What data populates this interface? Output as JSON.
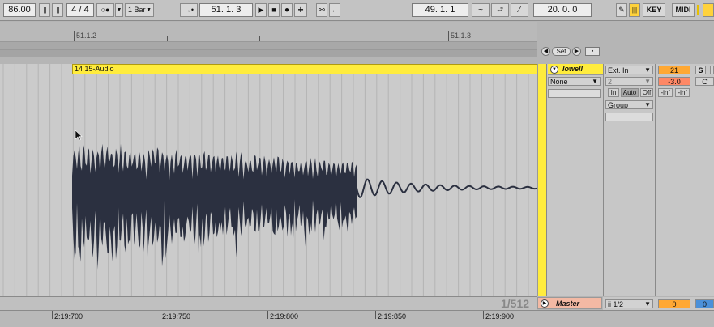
{
  "transport": {
    "tempo": "86.00",
    "signature": "4 / 4",
    "metronome": "○●",
    "quantize": "1 Bar",
    "position": "51.   1.   3",
    "loop_start": "49.   1.   1",
    "loop_length": "20.   0.   0",
    "key_label": "KEY",
    "midi_label": "MIDI"
  },
  "ruler": {
    "bar_1": "51.1.2",
    "bar_2": "51.1.3"
  },
  "clip": {
    "name": "14 15-Audio",
    "page_indicator": "1/512"
  },
  "set_button": "Set",
  "time_ruler": [
    "2:19:700",
    "2:19:750",
    "2:19:800",
    "2:19:850",
    "2:19:900"
  ],
  "track": {
    "name": "lowell",
    "input_type": "Ext. In",
    "input_channel": "2",
    "monitor_in": "In",
    "monitor_auto": "Auto",
    "monitor_off": "Off",
    "output_type": "None",
    "output_target": "Group",
    "volume": "21",
    "pan": "-3.0",
    "solo": "S",
    "peak_left": "-inf",
    "peak_right": "-inf",
    "crossfade": "C"
  },
  "master": {
    "name": "Master",
    "output": "ii 1/2",
    "volume": "0",
    "pan": "0"
  },
  "colors": {
    "clip": "#ffec3d",
    "waveform": "#2b3040",
    "volume": "#ffa833",
    "pan": "#ff8866",
    "master_name": "#f3b9a4",
    "master_pan": "#4a90d9"
  }
}
